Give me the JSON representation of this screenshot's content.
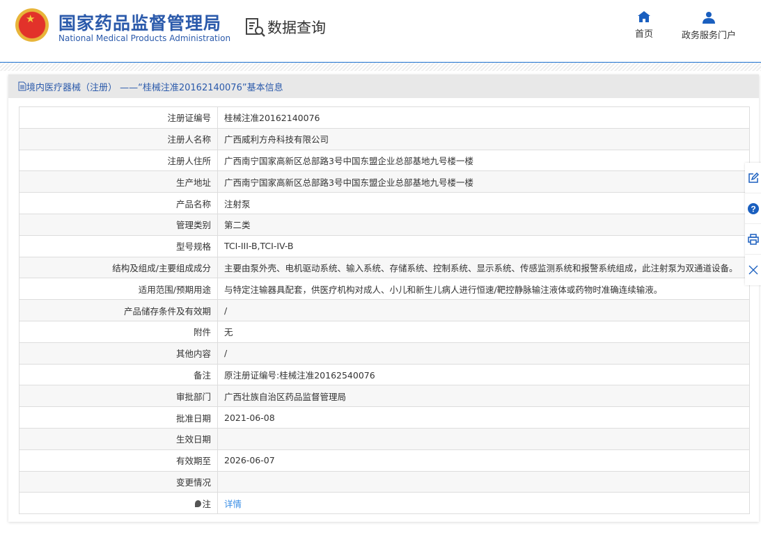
{
  "header": {
    "brand_cn": "国家药品监督管理局",
    "brand_en": "National Medical Products Administration",
    "section": "数据查询",
    "nav": [
      {
        "label": "首页"
      },
      {
        "label": "政务服务门户"
      }
    ]
  },
  "panel": {
    "title": "境内医疗器械（注册） ——“桂械注准20162140076”基本信息"
  },
  "rows": [
    {
      "label": "注册证编号",
      "value": "桂械注准20162140076"
    },
    {
      "label": "注册人名称",
      "value": "广西威利方舟科技有限公司"
    },
    {
      "label": "注册人住所",
      "value": "广西南宁国家高新区总部路3号中国东盟企业总部基地九号楼一楼"
    },
    {
      "label": "生产地址",
      "value": "广西南宁国家高新区总部路3号中国东盟企业总部基地九号楼一楼"
    },
    {
      "label": "产品名称",
      "value": "注射泵"
    },
    {
      "label": "管理类别",
      "value": "第二类"
    },
    {
      "label": "型号规格",
      "value": "TCI-III-B,TCI-IV-B"
    },
    {
      "label": "结构及组成/主要组成成分",
      "value": "主要由泵外壳、电机驱动系统、输入系统、存储系统、控制系统、显示系统、传感监测系统和报警系统组成，此注射泵为双通道设备。"
    },
    {
      "label": "适用范围/预期用途",
      "value": "与特定注输器具配套，供医疗机构对成人、小儿和新生儿病人进行恒速/靶控静脉输注液体或药物时准确连续输液。"
    },
    {
      "label": "产品储存条件及有效期",
      "value": "/"
    },
    {
      "label": "附件",
      "value": "无"
    },
    {
      "label": "其他内容",
      "value": "/"
    },
    {
      "label": "备注",
      "value": "原注册证编号:桂械注准20162540076"
    },
    {
      "label": "审批部门",
      "value": "广西壮族自治区药品监督管理局"
    },
    {
      "label": "批准日期",
      "value": "2021-06-08"
    },
    {
      "label": "生效日期",
      "value": ""
    },
    {
      "label": "有效期至",
      "value": "2026-06-07"
    },
    {
      "label": "变更情况",
      "value": ""
    }
  ],
  "note": {
    "label": "注",
    "link": "详情"
  }
}
